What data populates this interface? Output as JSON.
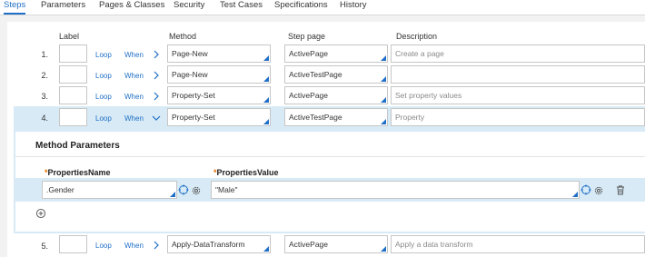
{
  "tabs": [
    "Steps",
    "Parameters",
    "Pages & Classes",
    "Security",
    "Test Cases",
    "Specifications",
    "History"
  ],
  "headers": {
    "label": "Label",
    "method": "Method",
    "step_page": "Step page",
    "description": "Description"
  },
  "steps": [
    {
      "num": "1.",
      "loop": "Loop",
      "when": "When",
      "method": "Page-New",
      "step_page": "ActivePage",
      "description": "Create a page"
    },
    {
      "num": "2.",
      "loop": "Loop",
      "when": "When",
      "method": "Page-New",
      "step_page": "ActiveTestPage",
      "description": ""
    },
    {
      "num": "3.",
      "loop": "Loop",
      "when": "When",
      "method": "Property-Set",
      "step_page": "ActivePage",
      "description": "Set property values"
    },
    {
      "num": "4.",
      "loop": "Loop",
      "when": "When",
      "method": "Property-Set",
      "step_page": "ActiveTestPage",
      "description": "Property"
    },
    {
      "num": "5.",
      "loop": "Loop",
      "when": "When",
      "method": "Apply-DataTransform",
      "step_page": "ActivePage",
      "description": "Apply a data transform"
    }
  ],
  "method_parameters": {
    "title": "Method Parameters",
    "required_marker": "*",
    "properties_name_label": "PropertiesName",
    "properties_value_label": "PropertiesValue",
    "properties_name_value": ".Gender",
    "properties_value_value": "\"Male\""
  },
  "colors": {
    "accent": "#1f6fc6",
    "row_highlight": "#d7eaf6",
    "required": "#e07000"
  }
}
